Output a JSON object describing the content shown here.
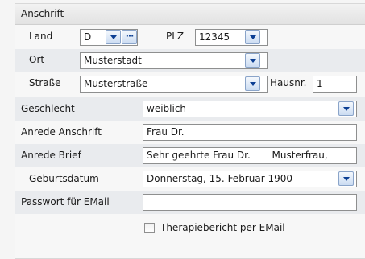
{
  "section": {
    "title": "Anschrift"
  },
  "land": {
    "label": "Land",
    "value": "D"
  },
  "plz": {
    "label": "PLZ",
    "value": "12345"
  },
  "ort": {
    "label": "Ort",
    "value": "Musterstadt"
  },
  "strasse": {
    "label": "Straße",
    "value": "Musterstraße"
  },
  "hausnr": {
    "label": "Hausnr.",
    "value": "1"
  },
  "geschlecht": {
    "label": "Geschlecht",
    "value": "weiblich"
  },
  "anrede_anschrift": {
    "label": "Anrede Anschrift",
    "value": "Frau Dr."
  },
  "anrede_brief": {
    "label": "Anrede Brief",
    "value": "Sehr geehrte Frau Dr.       Musterfrau,"
  },
  "geburtsdatum": {
    "label": "Geburtsdatum",
    "value": "Donnerstag, 15. Februar 1900"
  },
  "passwort_email": {
    "label": "Passwort für EMail",
    "value": ""
  },
  "therapiebericht": {
    "label": "Therapiebericht per EMail",
    "checked": false
  },
  "colors": {
    "accent": "#0c3f93",
    "row_alt": "#e9ebee",
    "field_border": "#8e8f8f"
  }
}
